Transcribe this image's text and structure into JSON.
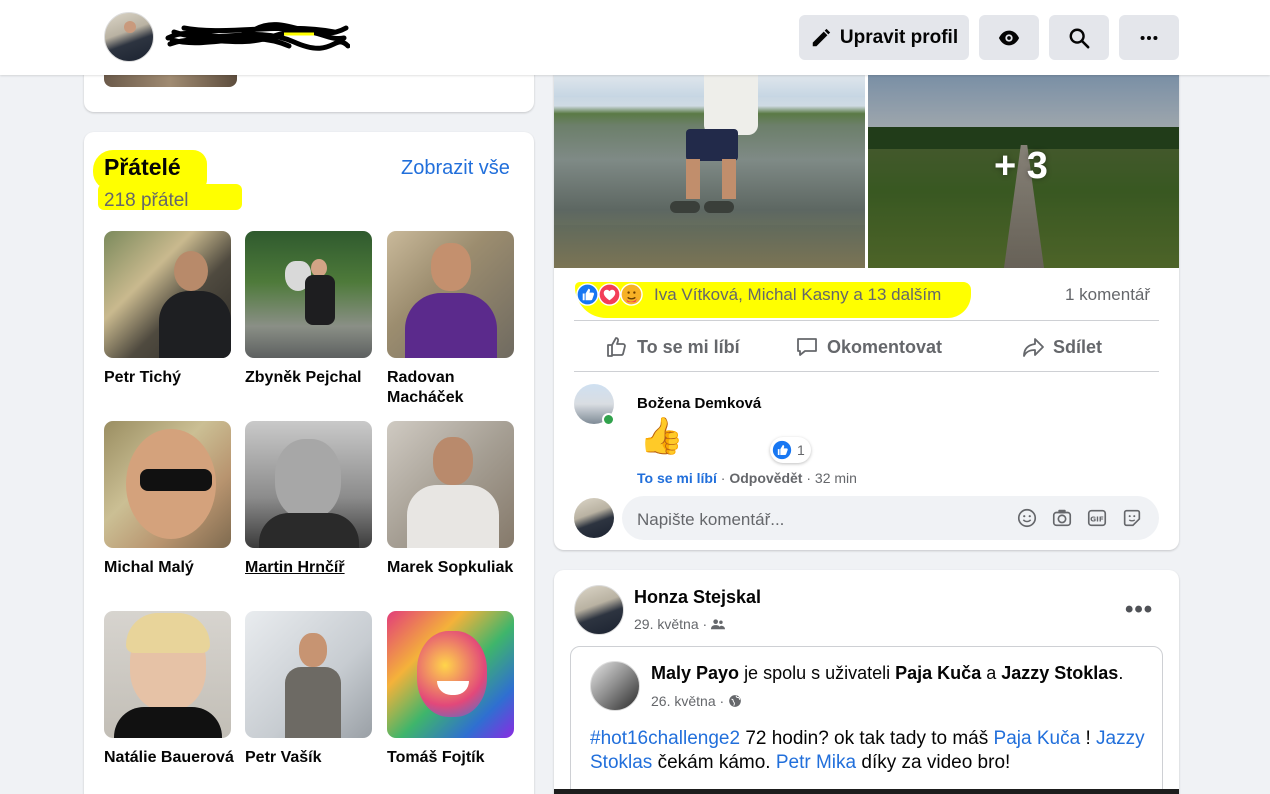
{
  "header": {
    "edit_profile": "Upravit profil"
  },
  "friends": {
    "title": "Přátelé",
    "count": "218 přátel",
    "see_all": "Zobrazit vše",
    "items": [
      {
        "name": "Petr Tichý"
      },
      {
        "name": "Zbyněk Pejchal"
      },
      {
        "name": "Radovan Macháček"
      },
      {
        "name": "Michal Malý"
      },
      {
        "name": "Martin Hrnčíř"
      },
      {
        "name": "Marek Sopkuliak"
      },
      {
        "name": "Natálie Bauerová"
      },
      {
        "name": "Petr Vašík"
      },
      {
        "name": "Tomáš Fojtík"
      }
    ]
  },
  "post": {
    "more_photos": "+ 3",
    "reactions_names": "Iva Vítková, Michal Kasny a 13 dalším",
    "comments_count": "1 komentář",
    "actions": {
      "like": "To se mi líbí",
      "comment": "Okomentovat",
      "share": "Sdílet"
    },
    "comment": {
      "author": "Božena Demková",
      "emoji": "👍",
      "reaction_count": "1",
      "like": "To se mi líbí",
      "reply": "Odpovědět",
      "time": "32 min"
    },
    "comment_placeholder": "Napište komentář..."
  },
  "post2": {
    "author": "Honza Stejskal",
    "date": "29. května",
    "shared": {
      "author": "Maly Payo",
      "with_text": "je spolu s uživateli",
      "with1": "Paja Kuča",
      "and": "a",
      "with2": "Jazzy Stoklas",
      "date": "26. května",
      "text": {
        "hashtag": "#hot16challenge2",
        "t1": "72 hodin? ok tak tady to máš",
        "m1": "Paja Kuča",
        "t2": "!",
        "m2": "Jazzy Stoklas",
        "t3": "čekám kámo.",
        "m3": "Petr Mika",
        "t4": "díky za video bro!"
      }
    }
  },
  "colors": {
    "accent": "#216fdb",
    "highlight": "#ffff00",
    "muted": "#65676b"
  }
}
